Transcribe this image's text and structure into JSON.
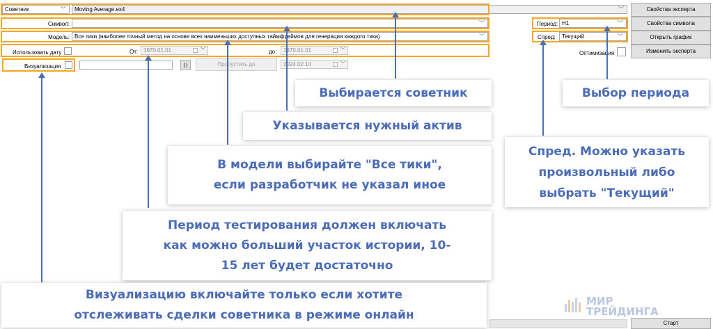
{
  "expert_row": {
    "type_select": "Советник",
    "expert_file": "Moving Average.ex4",
    "expert_props_button": "Свойства эксперта"
  },
  "symbol_row": {
    "label": "Символ:",
    "value": "",
    "period_label": "Период:",
    "period_value": "H1",
    "symbol_props_button": "Свойства символа"
  },
  "model_row": {
    "label": "Модель:",
    "value": "Все тики (наиболее точный метод на основе всех наименьших доступных таймфреймов для генерации каждого тика)",
    "spread_label": "Спред:",
    "spread_value": "Текущий",
    "open_chart_button": "Открыть график"
  },
  "date_row": {
    "use_date_label": "Использовать дату",
    "from_label": "От:",
    "from_value": "1970.01.01",
    "to_label": "до:",
    "to_value": "1970.01.01",
    "optimization_label": "Оптимизация",
    "change_expert_button": "Изменить эксперта"
  },
  "visual_row": {
    "label": "Визуализация",
    "pause_button": "| |",
    "skip_button": "Пропустить до",
    "skip_date": "2024.02.14"
  },
  "start_button": "Старт",
  "callouts": {
    "expert": "Выбирается советник",
    "period": "Выбор периода",
    "symbol": "Указывается нужный актив",
    "spread": [
      "Спред. Можно указать",
      "произвольный либо",
      "выбрать \"Текущий\""
    ],
    "model": [
      "В модели выбирайте \"Все тики\",",
      "если разработчик не указал иное"
    ],
    "test_period": [
      "Период тестирования должен включать",
      "как можно больший участок истории, 10-",
      "15 лет будет достаточно"
    ],
    "visualization": [
      "Визуализацию включайте только если хотите",
      "отслеживать сделки советника в режиме онлайн"
    ]
  },
  "logo": {
    "line1": "МИР",
    "line2": "ТРЕЙДИНГА"
  },
  "colors": {
    "highlight": "#f5a623",
    "callout_text": "#4b6cb7",
    "arrow": "#4a6fb5"
  }
}
